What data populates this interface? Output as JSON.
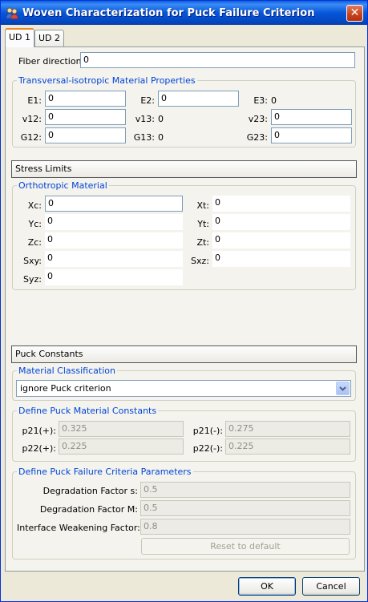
{
  "window": {
    "title": "Woven Characterization for Puck Failure Criterion",
    "close_label": "✕"
  },
  "tabs": [
    {
      "label": "UD 1"
    },
    {
      "label": "UD 2"
    }
  ],
  "fiber": {
    "label": "Fiber direction:",
    "value": "0"
  },
  "transversal": {
    "title": "Transversal-isotropic Material Properties",
    "e1": {
      "label": "E1:",
      "value": "0"
    },
    "e2": {
      "label": "E2:",
      "value": "0"
    },
    "e3": {
      "label": "E3:",
      "value": "0"
    },
    "v12": {
      "label": "v12:",
      "value": "0"
    },
    "v13": {
      "label": "v13:",
      "value": "0"
    },
    "v23": {
      "label": "v23:",
      "value": "0"
    },
    "g12": {
      "label": "G12:",
      "value": "0"
    },
    "g13": {
      "label": "G13:",
      "value": "0"
    },
    "g23": {
      "label": "G23:",
      "value": "0"
    }
  },
  "stress": {
    "header": "Stress Limits",
    "group_title": "Orthotropic Material",
    "xc": {
      "label": "Xc:",
      "value": "0"
    },
    "xt": {
      "label": "Xt:",
      "value": "0"
    },
    "yc": {
      "label": "Yc:",
      "value": "0"
    },
    "yt": {
      "label": "Yt:",
      "value": "0"
    },
    "zc": {
      "label": "Zc:",
      "value": "0"
    },
    "zt": {
      "label": "Zt:",
      "value": "0"
    },
    "sxy": {
      "label": "Sxy:",
      "value": "0"
    },
    "sxz": {
      "label": "Sxz:",
      "value": "0"
    },
    "syz": {
      "label": "Syz:",
      "value": "0"
    }
  },
  "puck": {
    "header": "Puck Constants",
    "classification_title": "Material Classification",
    "classification_value": "ignore Puck criterion",
    "constants_title": "Define Puck Material Constants",
    "p21_plus": {
      "label": "p21(+):",
      "value": "0.325"
    },
    "p21_minus": {
      "label": "p21(-):",
      "value": "0.275"
    },
    "p22_plus": {
      "label": "p22(+):",
      "value": "0.225"
    },
    "p22_minus": {
      "label": "p22(-):",
      "value": "0.225"
    },
    "params_title": "Define Puck Failure Criteria Parameters",
    "degradation_s": {
      "label": "Degradation Factor s:",
      "value": "0.5"
    },
    "degradation_m": {
      "label": "Degradation Factor M:",
      "value": "0.5"
    },
    "interface": {
      "label": "Interface Weakening Factor:",
      "value": "0.8"
    },
    "reset_label": "Reset to default"
  },
  "buttons": {
    "ok": "OK",
    "cancel": "Cancel"
  },
  "colors": {
    "titlebar": "#0556d8",
    "group_title": "#0046d5",
    "tab_accent": "#e68b2c"
  }
}
